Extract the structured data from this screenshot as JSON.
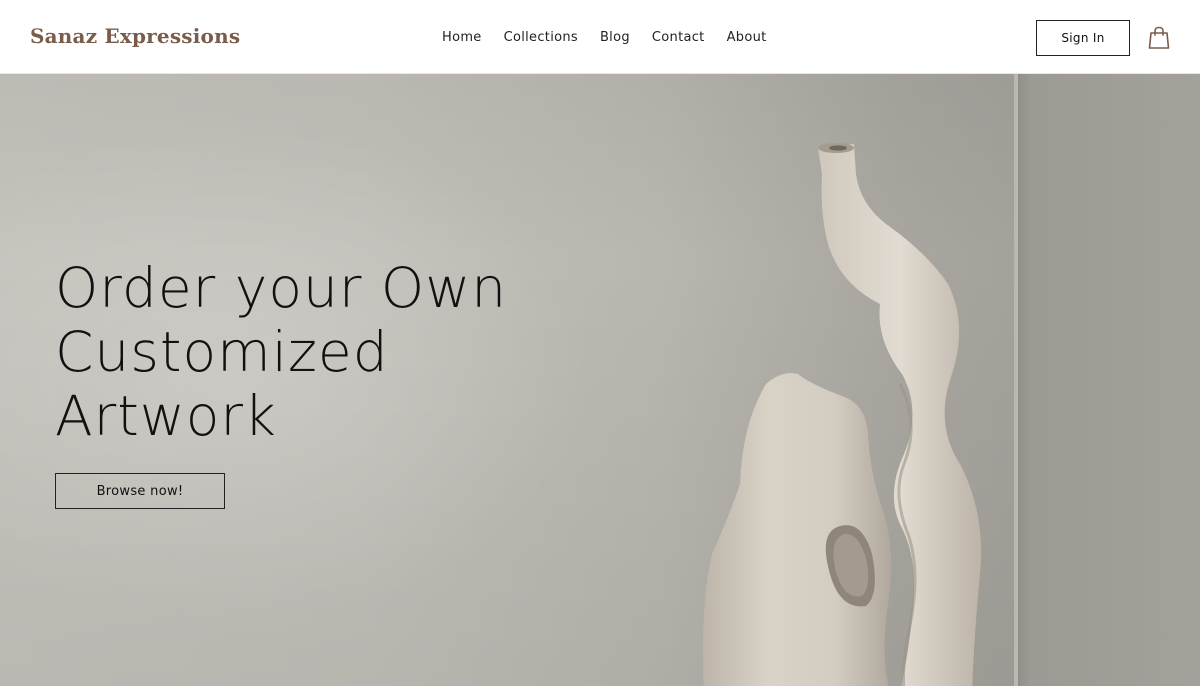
{
  "brand": {
    "name": "Sanaz Expressions",
    "color": "#7a5c4b"
  },
  "nav": {
    "items": [
      {
        "label": "Home"
      },
      {
        "label": "Collections"
      },
      {
        "label": "Blog"
      },
      {
        "label": "Contact"
      },
      {
        "label": "About"
      }
    ]
  },
  "header": {
    "sign_in_label": "Sign In",
    "cart_icon": "shopping-bag-icon"
  },
  "hero": {
    "headline_lines": [
      "Order your Own",
      "Customized",
      "Artwork"
    ],
    "cta_label": "Browse now!",
    "image": "abstract ceramic sculpture against grey wall"
  }
}
